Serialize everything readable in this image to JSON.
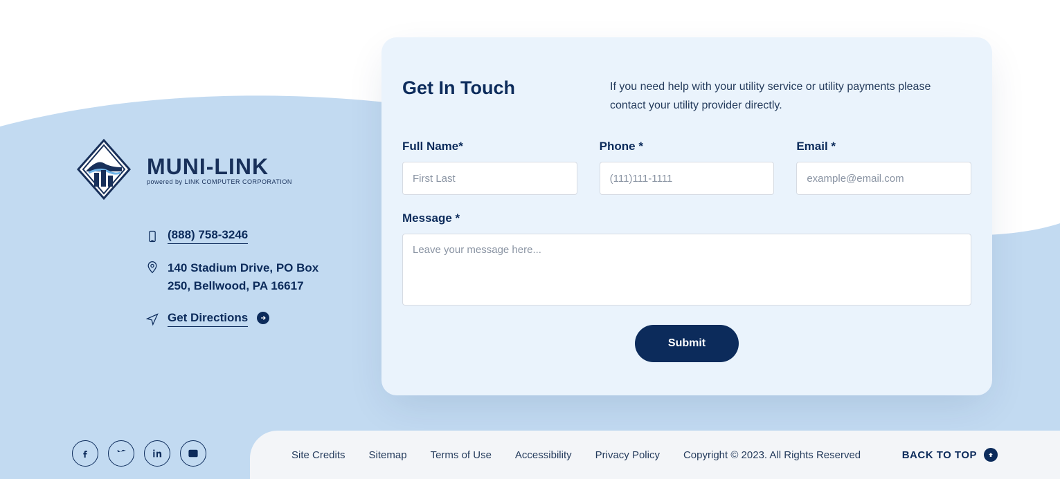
{
  "brand": {
    "name": "MUNI-LINK",
    "tagline": "powered by LINK COMPUTER CORPORATION"
  },
  "contact": {
    "phone": "(888) 758-3246",
    "address": "140 Stadium Drive, PO Box 250, Bellwood, PA 16617",
    "directions": "Get Directions"
  },
  "form": {
    "title": "Get In Touch",
    "note": "If you need help with your utility service or utility payments please contact your utility provider directly.",
    "full_name_label": "Full Name*",
    "full_name_placeholder": "First Last",
    "phone_label": "Phone *",
    "phone_placeholder": "(111)111-1111",
    "email_label": "Email *",
    "email_placeholder": "example@email.com",
    "message_label": "Message *",
    "message_placeholder": "Leave your message here...",
    "submit_label": "Submit"
  },
  "footer": {
    "links": {
      "site_credits": "Site Credits",
      "sitemap": "Sitemap",
      "terms": "Terms of Use",
      "accessibility": "Accessibility",
      "privacy": "Privacy Policy"
    },
    "copyright": "Copyright © 2023. All Rights Reserved",
    "back_to_top": "BACK TO TOP"
  }
}
